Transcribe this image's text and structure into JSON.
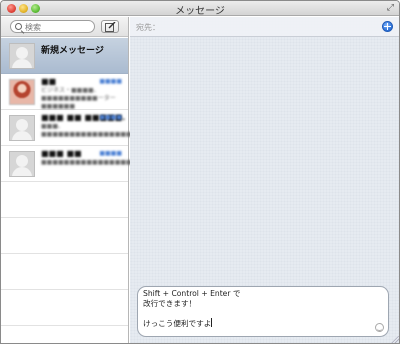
{
  "window": {
    "title": "メッセージ"
  },
  "search": {
    "placeholder": "検索"
  },
  "conversations": [
    {
      "name": "新規メッセージ",
      "selected": true
    },
    {
      "name": "■■",
      "time": "■■■■",
      "preview": "ビジネス・■■■■、■■■■■■■■■■ーター■■■■■■"
    },
    {
      "name": "■■■ ■■ ■■■■■...",
      "time": "■■■■",
      "preview": "■■■、■■■■■■■■■■■■■■■■■■■■■■■■■■"
    },
    {
      "name": "■■■ ■■",
      "time": "■■■■",
      "preview": "■■■■■■■■■■■■■■■■■■■■■■"
    }
  ],
  "compose": {
    "to_label": "宛先："
  },
  "composer": {
    "text": "Shift + Control + Enter で\n改行できます！\n\nけっこう便利ですよ"
  }
}
